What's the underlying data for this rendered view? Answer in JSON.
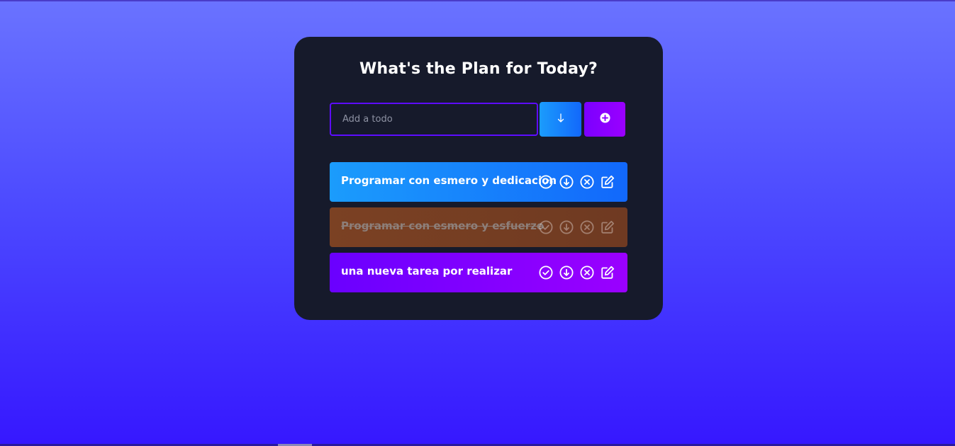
{
  "app": {
    "title": "What's the Plan for Today?"
  },
  "form": {
    "placeholder": "Add a todo",
    "value": "",
    "down_icon": "arrow-down-icon",
    "add_icon": "plus-circle-icon"
  },
  "todos": [
    {
      "text": "Programar con esmero y dedicacion",
      "completed": false,
      "color": "#1b9cfc"
    },
    {
      "text": "Programar con esmero y esfuerzo",
      "completed": true,
      "color": "#7b4123"
    },
    {
      "text": "una nueva tarea por realizar",
      "completed": false,
      "color": "#6a00ff"
    }
  ],
  "row_icons": [
    "check-circle-icon",
    "arrow-down-circle-icon",
    "close-circle-icon",
    "edit-icon"
  ],
  "colors": {
    "accent_purple": "#5d0cff",
    "card_bg": "#161a2b",
    "blue": "#1268fb",
    "purple": "#9a00ff"
  }
}
